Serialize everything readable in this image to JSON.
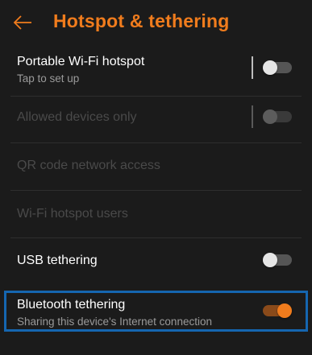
{
  "header": {
    "title": "Hotspot & tethering",
    "back_icon": "arrow-left-icon"
  },
  "colors": {
    "accent": "#f07c1d",
    "highlight_border": "#1566b0",
    "background": "#1b1b1b"
  },
  "settings": {
    "portable_hotspot": {
      "label": "Portable Wi-Fi hotspot",
      "subtitle": "Tap to set up",
      "toggle": "off"
    },
    "allowed_devices": {
      "label": "Allowed devices only",
      "toggle": "off",
      "disabled": true
    },
    "qr_code": {
      "label": "QR code network access",
      "disabled": true
    },
    "hotspot_users": {
      "label": "Wi-Fi hotspot users",
      "disabled": true
    },
    "usb_tethering": {
      "label": "USB tethering",
      "toggle": "off"
    },
    "bluetooth_tethering": {
      "label": "Bluetooth tethering",
      "subtitle": "Sharing this device's Internet connection",
      "toggle": "on"
    }
  }
}
